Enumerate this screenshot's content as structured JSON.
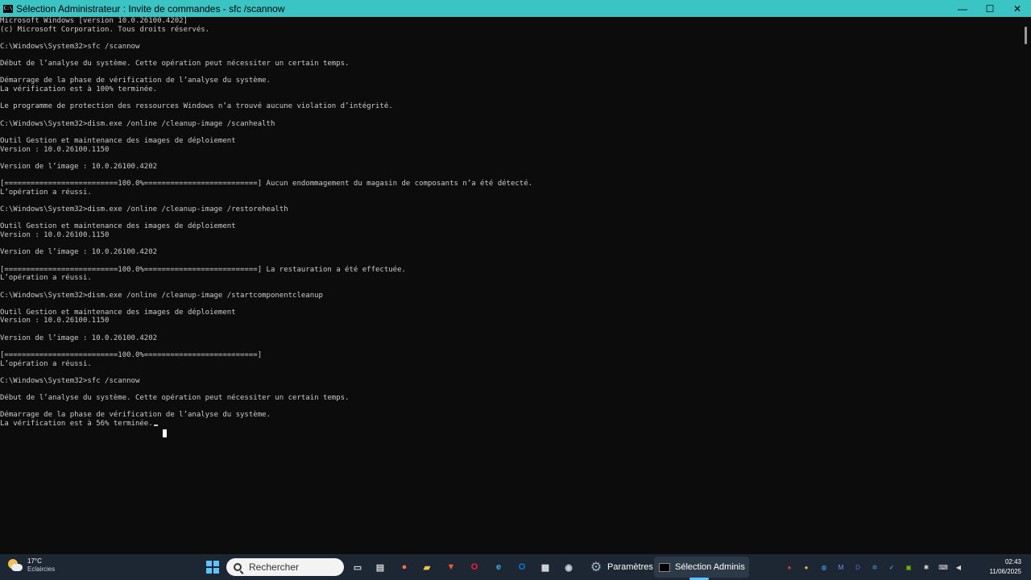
{
  "window": {
    "title": "Sélection Administrateur : Invite de commandes - sfc  /scannow",
    "app_icon_text": "C:\\",
    "minimize": "—",
    "maximize": "☐",
    "close": "✕"
  },
  "console": {
    "lines": [
      "Microsoft Windows [version 10.0.26100.4202]",
      "(c) Microsoft Corporation. Tous droits réservés.",
      "",
      "C:\\Windows\\System32>sfc /scannow",
      "",
      "Début de l’analyse du système. Cette opération peut nécessiter un certain temps.",
      "",
      "Démarrage de la phase de vérification de l’analyse du système.",
      "La vérification est à 100% terminée.",
      "",
      "Le programme de protection des ressources Windows n’a trouvé aucune violation d’intégrité.",
      "",
      "C:\\Windows\\System32>dism.exe /online /cleanup-image /scanhealth",
      "",
      "Outil Gestion et maintenance des images de déploiement",
      "Version : 10.0.26100.1150",
      "",
      "Version de l’image : 10.0.26100.4202",
      "",
      "[==========================100.0%==========================] Aucun endommagement du magasin de composants n’a été détecté.",
      "L’opération a réussi.",
      "",
      "C:\\Windows\\System32>dism.exe /online /cleanup-image /restorehealth",
      "",
      "Outil Gestion et maintenance des images de déploiement",
      "Version : 10.0.26100.1150",
      "",
      "Version de l’image : 10.0.26100.4202",
      "",
      "[==========================100.0%==========================] La restauration a été effectuée.",
      "L’opération a réussi.",
      "",
      "C:\\Windows\\System32>dism.exe /online /cleanup-image /startcomponentcleanup",
      "",
      "Outil Gestion et maintenance des images de déploiement",
      "Version : 10.0.26100.1150",
      "",
      "Version de l’image : 10.0.26100.4202",
      "",
      "[==========================100.0%==========================]",
      "L’opération a réussi.",
      "",
      "C:\\Windows\\System32>sfc /scannow",
      "",
      "Début de l’analyse du système. Cette opération peut nécessiter un certain temps.",
      "",
      "Démarrage de la phase de vérification de l’analyse du système.",
      "La vérification est à 56% terminée."
    ],
    "progress_percent": 56
  },
  "taskbar": {
    "weather": {
      "temperature": "17°C",
      "condition": "Eclaircies",
      "icon": "partly-sunny-icon"
    },
    "search_placeholder": "Rechercher",
    "apps": [
      {
        "name": "task-view-icon",
        "glyph": "▭",
        "color": "#cfd8e3"
      },
      {
        "name": "widgets-icon",
        "glyph": "▤",
        "color": "#d0d0d0"
      },
      {
        "name": "firefox-icon",
        "glyph": "●",
        "color": "#ff7139"
      },
      {
        "name": "file-explorer-icon",
        "glyph": "▰",
        "color": "#f5c542"
      },
      {
        "name": "brave-icon",
        "glyph": "▼",
        "color": "#fb542b"
      },
      {
        "name": "opera-icon",
        "glyph": "O",
        "color": "#ff1b2d"
      },
      {
        "name": "edge-icon",
        "glyph": "e",
        "color": "#2bb6e8"
      },
      {
        "name": "outlook-icon",
        "glyph": "O",
        "color": "#0f78d4"
      },
      {
        "name": "store-icon",
        "glyph": "▦",
        "color": "#e0e0e0"
      },
      {
        "name": "steam-icon",
        "glyph": "◉",
        "color": "#c7d5e0"
      }
    ],
    "settings_label": "Paramètres",
    "terminal_label": "Sélection Adminis",
    "tray": [
      {
        "name": "record-icon",
        "glyph": "●",
        "color": "#e03a3a"
      },
      {
        "name": "yellow-app-icon",
        "glyph": "●",
        "color": "#f2b63a"
      },
      {
        "name": "globe-icon",
        "glyph": "◍",
        "color": "#4aa3f0"
      },
      {
        "name": "m-app-icon",
        "glyph": "M",
        "color": "#7b8cff"
      },
      {
        "name": "d-app-icon",
        "glyph": "D",
        "color": "#6a5acd"
      },
      {
        "name": "settings-tray-icon",
        "glyph": "✲",
        "color": "#3aa0e0"
      },
      {
        "name": "security-icon",
        "glyph": "✓",
        "color": "#4cc2ff"
      },
      {
        "name": "nvidia-icon",
        "glyph": "▣",
        "color": "#76b900"
      },
      {
        "name": "bluetooth-icon",
        "glyph": "✱",
        "color": "#d8d8d8"
      },
      {
        "name": "keyboard-icon",
        "glyph": "⌨",
        "color": "#d8d8d8"
      },
      {
        "name": "volume-icon",
        "glyph": "◀",
        "color": "#d8d8d8"
      }
    ],
    "time": "02:43",
    "date": "11/06/2025"
  }
}
